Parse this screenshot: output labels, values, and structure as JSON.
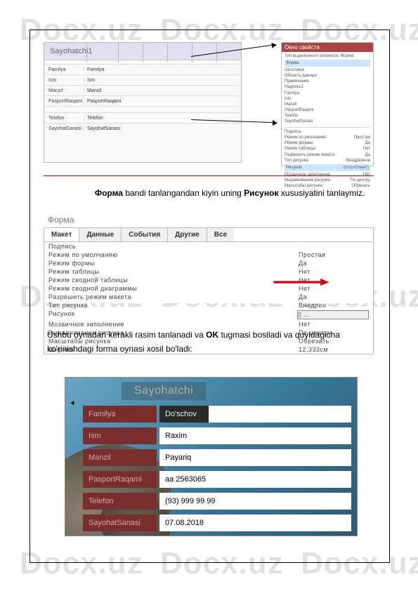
{
  "watermarks": [
    "Docx.uz",
    "Docx.uz",
    "Docx.uz",
    "Docx.uz",
    "Docx.uz",
    "Docx.uz",
    "Docx.uz",
    "Docx.uz",
    "Docx.uz"
  ],
  "paragraph1_pre": "Форма",
  "paragraph1_mid": " bandi tanlangandan kiyin uning ",
  "paragraph1_bold2": "Рисунок",
  "paragraph1_end": " xususiyatini tanlaymiz.",
  "paragraph2_pre": "Ushbu oynadan kerakli rasim tanlanadi va ",
  "paragraph2_bold": "OK",
  "paragraph2_end": " tugmasi bosiladi va quyidagicha ko'rinishdagi forma oynasi xosil bo'ladi:",
  "ss1": {
    "form_title": "Sayohatchi1",
    "rows": [
      {
        "label": "Familya",
        "value": "Familya"
      },
      {
        "label": "Ism",
        "value": "Ism"
      },
      {
        "label": "Manzil",
        "value": "Manzil"
      },
      {
        "label": "PasportRaqami",
        "value": "PasportRaqami"
      },
      {
        "label": "Telefon",
        "value": "Telefon"
      },
      {
        "label": "SayohatSanasi",
        "value": "SayohatSanasi"
      }
    ],
    "panel_title": "Окно свойств"
  },
  "ss2": {
    "title": "Форма",
    "tabs": [
      "Макет",
      "Данные",
      "События",
      "Другие",
      "Все"
    ],
    "items": [
      {
        "k": "Подпись",
        "v": ""
      },
      {
        "k": "Режим по умолчанию",
        "v": "Простая"
      },
      {
        "k": "Режим формы",
        "v": "Да"
      },
      {
        "k": "Режим таблицы",
        "v": "Нет"
      },
      {
        "k": "Режим сводной таблицы",
        "v": "Нет"
      },
      {
        "k": "Режим сводной диаграммы",
        "v": "Нет"
      },
      {
        "k": "Разрешить режим макета",
        "v": "Да"
      },
      {
        "k": "Тип рисунка",
        "v": "Внедрен"
      },
      {
        "k": "Рисунок",
        "v": "▯ ..."
      },
      {
        "k": "Мозаичное заполнение",
        "v": "Нет"
      },
      {
        "k": "Выравнивание рисунка",
        "v": "По центру"
      },
      {
        "k": "Масштабы рисунка",
        "v": "Обрезать"
      },
      {
        "k": "Ширина",
        "v": "12,333см"
      }
    ]
  },
  "ss3": {
    "title": "Sayohatchi",
    "rows": [
      {
        "label": "Familya",
        "value": "Do'schov",
        "dark": true
      },
      {
        "label": "Ism",
        "value": "Raxim"
      },
      {
        "label": "Manzil",
        "value": "Payariq"
      },
      {
        "label": "PasportRaqami",
        "value": "aa 2563065"
      },
      {
        "label": "Telefon",
        "value": "(93) 999 99 99"
      },
      {
        "label": "SayohatSanasi",
        "value": "07.08.2018"
      }
    ]
  }
}
